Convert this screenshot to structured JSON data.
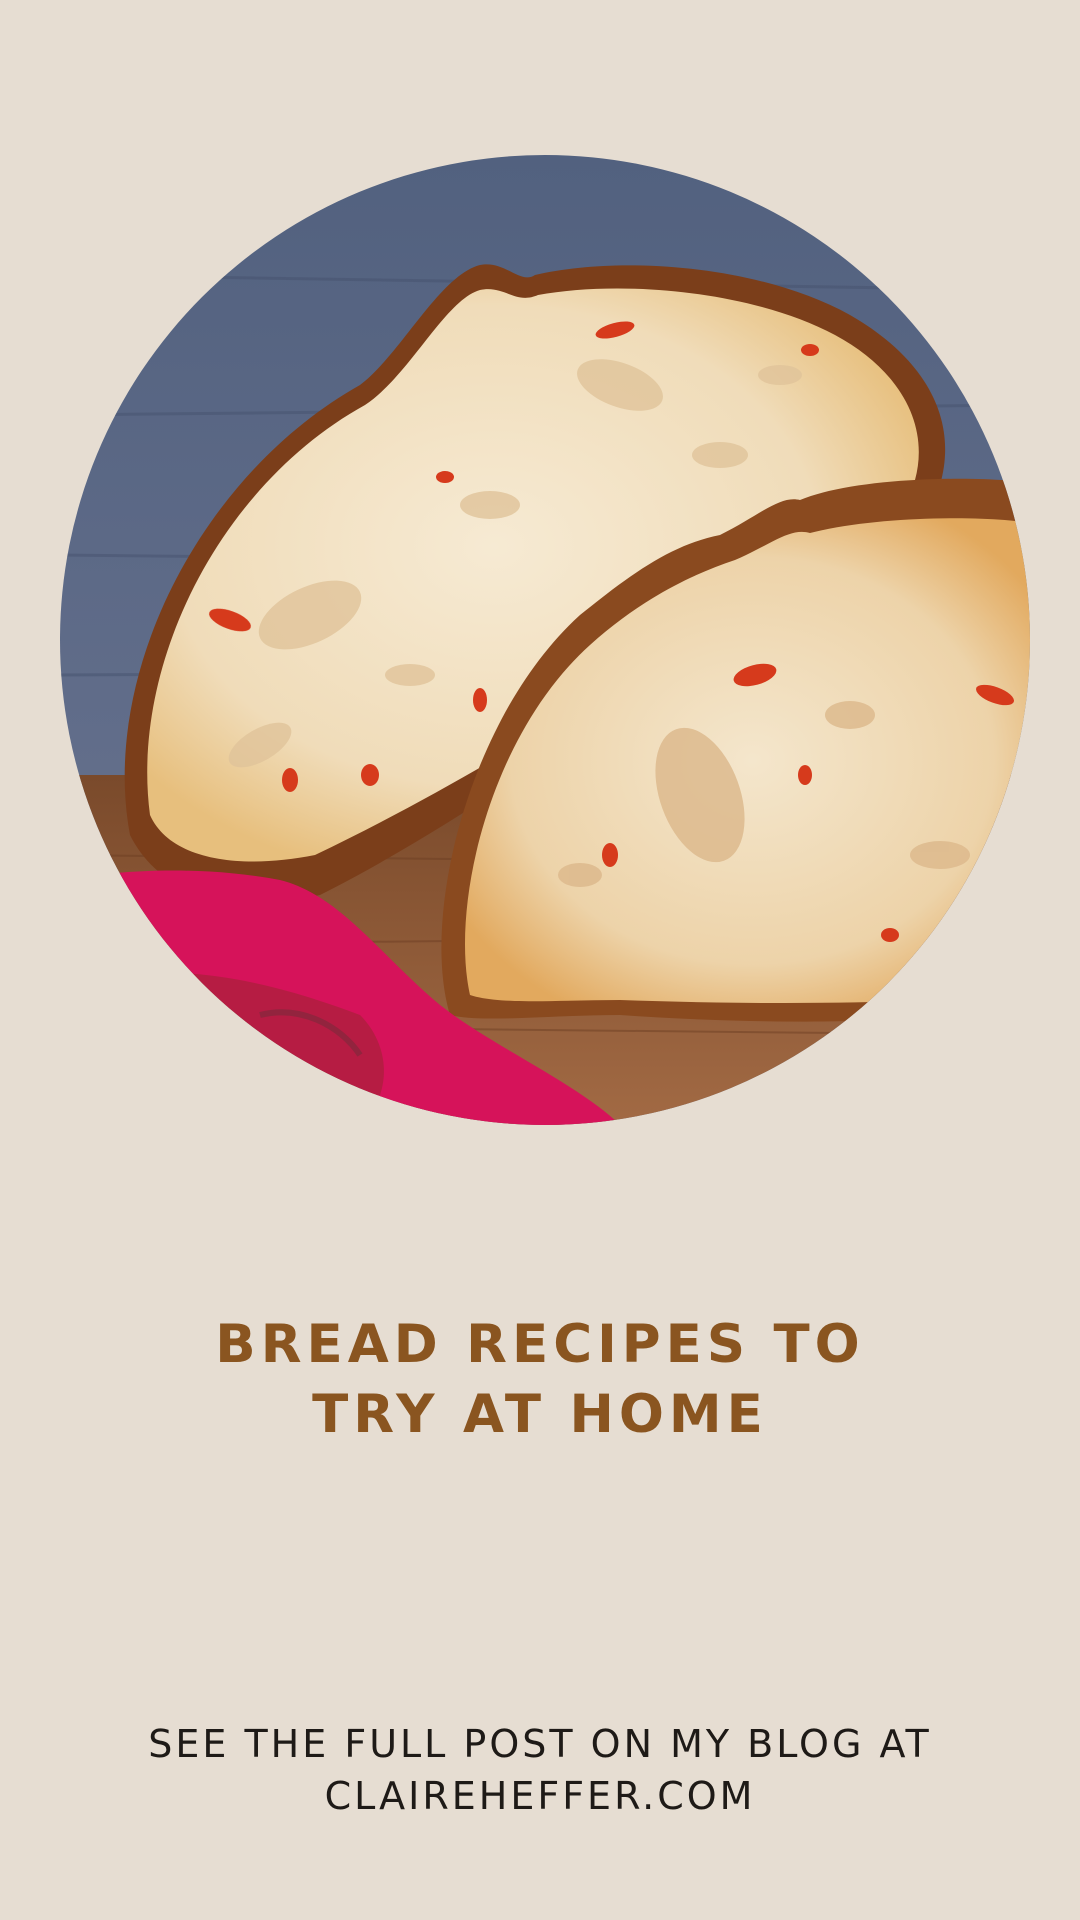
{
  "hero": {
    "image_subject": "sliced sourdough bread with red peppers on a wooden board with a pink cloth",
    "background_color": "#e6ddd2"
  },
  "headline": {
    "line1": "BREAD RECIPES TO",
    "line2": "TRY AT HOME",
    "color": "#8a5520"
  },
  "footer": {
    "line1": "SEE THE FULL POST ON MY BLOG AT",
    "line2": "CLAIREHEFFER.COM",
    "color": "#1e1a17"
  }
}
